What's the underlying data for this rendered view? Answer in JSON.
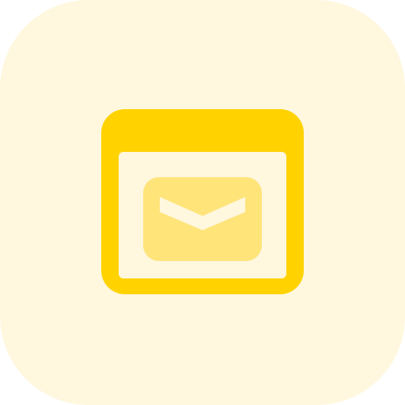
{
  "icon": {
    "name": "browser-mail-icon",
    "colors": {
      "tile_background": "#FFF7DE",
      "window_frame": "#FFD200",
      "window_content": "#FFF7DE",
      "envelope_body": "#FFE47A",
      "envelope_flap": "#FFF7DE"
    }
  }
}
